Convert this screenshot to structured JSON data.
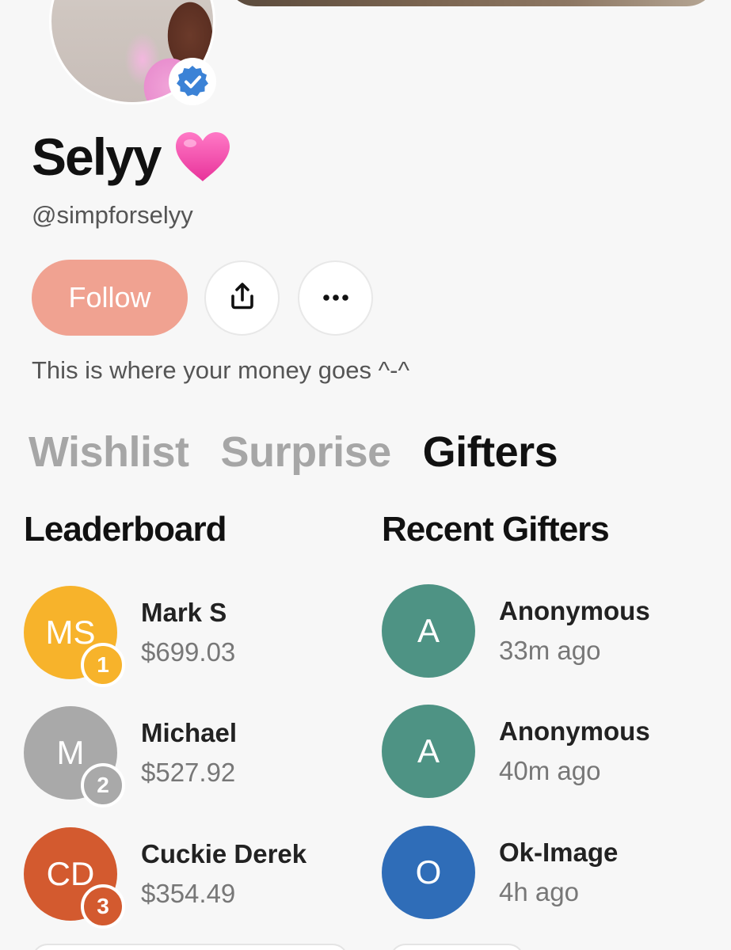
{
  "profile": {
    "name": "Selyy",
    "handle": "@simpforselyy",
    "bio": "This is where your money goes ^-^",
    "verified_icon": "verified-badge-icon",
    "name_emoji": "pink-heart-icon"
  },
  "actions": {
    "follow_label": "Follow",
    "share_icon": "share-icon",
    "more_icon": "more-icon"
  },
  "tabs": [
    {
      "label": "Wishlist",
      "active": false
    },
    {
      "label": "Surprise",
      "active": false
    },
    {
      "label": "Gifters",
      "active": true
    }
  ],
  "leaderboard": {
    "title": "Leaderboard",
    "entries": [
      {
        "initials": "MS",
        "name": "Mark S",
        "amount": "$699.03",
        "rank": "1",
        "color": "#F7B32B"
      },
      {
        "initials": "M",
        "name": "Michael",
        "amount": "$527.92",
        "rank": "2",
        "color": "#A9A9A9"
      },
      {
        "initials": "CD",
        "name": "Cuckie Derek",
        "amount": "$354.49",
        "rank": "3",
        "color": "#D35A2F"
      }
    ]
  },
  "recent": {
    "title": "Recent Gifters",
    "entries": [
      {
        "initials": "A",
        "name": "Anonymous",
        "time": "33m ago",
        "color": "#4E9384"
      },
      {
        "initials": "A",
        "name": "Anonymous",
        "time": "40m ago",
        "color": "#4E9384"
      },
      {
        "initials": "O",
        "name": "Ok-Image",
        "time": "4h ago",
        "color": "#2F6DB8"
      }
    ]
  },
  "colors": {
    "follow": "#F0A291",
    "verified": "#3B82D6",
    "heart": "#F54AA8"
  }
}
